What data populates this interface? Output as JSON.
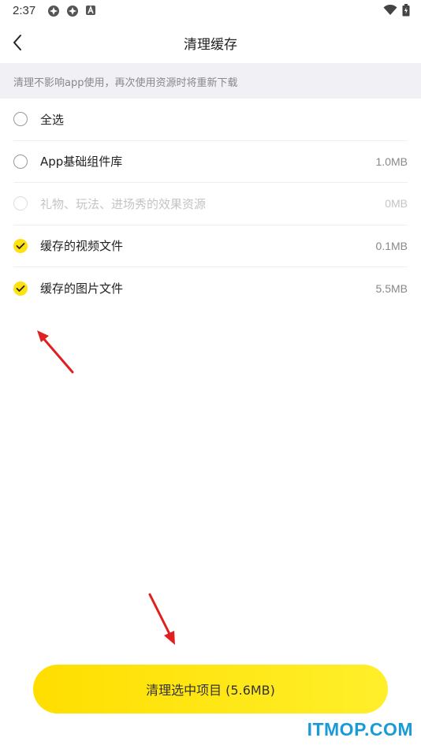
{
  "status_bar": {
    "time": "2:37",
    "icons": [
      "app-notification-icon",
      "app-notification-icon",
      "a-notification-icon"
    ],
    "right_icons": [
      "wifi-icon",
      "battery-charging-icon"
    ]
  },
  "header": {
    "title": "清理缓存",
    "back_icon": "chevron-left-icon"
  },
  "notice": {
    "text": "清理不影响app使用，再次使用资源时将重新下载"
  },
  "items": [
    {
      "label": "全选",
      "size": "",
      "checked": false,
      "disabled": false
    },
    {
      "label": "App基础组件库",
      "size": "1.0MB",
      "checked": false,
      "disabled": false
    },
    {
      "label": "礼物、玩法、进场秀的效果资源",
      "size": "0MB",
      "checked": false,
      "disabled": true
    },
    {
      "label": "缓存的视频文件",
      "size": "0.1MB",
      "checked": true,
      "disabled": false
    },
    {
      "label": "缓存的图片文件",
      "size": "5.5MB",
      "checked": true,
      "disabled": false
    }
  ],
  "button": {
    "label": "清理选中项目 (5.6MB)"
  },
  "watermark": "ITMOP.COM",
  "colors": {
    "accent": "#ffe10f",
    "arrow": "#e02020",
    "watermark": "#1a9bd7"
  }
}
